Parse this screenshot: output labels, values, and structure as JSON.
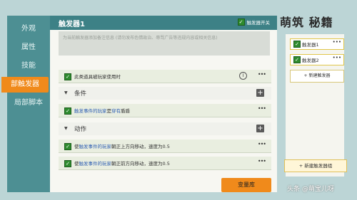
{
  "sidebar": {
    "items": [
      {
        "label": "外观"
      },
      {
        "label": "属性"
      },
      {
        "label": "技能"
      },
      {
        "label": "部触发器"
      },
      {
        "label": "局部脚本"
      }
    ]
  },
  "main": {
    "title": "触发器1",
    "toggle_label": "触发器开关",
    "note": "为当前触发器添加备注信息 (请勿发布色情政治、辱骂广告等违规内容或相关信息)",
    "condition_row": {
      "text": "此类道具被玩家使用时"
    },
    "sections": [
      {
        "label": "条件"
      },
      {
        "label": "动作"
      }
    ],
    "condition_items": [
      {
        "prefix": "触发事件的玩家",
        "mid": "是",
        "suffix": "穿有",
        "hl": "盾盾"
      }
    ],
    "action_items": [
      {
        "prefix": "使",
        "hl": "触发事件的玩家",
        "rest": "朝正上方向移动，速度为0.5"
      },
      {
        "prefix": "使",
        "hl": "触发事件的玩家",
        "rest": "朝正前方向移动，速度为0.5"
      }
    ],
    "bottom_button": "变量库"
  },
  "right": {
    "items": [
      {
        "label": "触发器1"
      },
      {
        "label": "触发器2"
      }
    ],
    "add_trigger": "新建触发器",
    "add_group": "新建触发器组"
  },
  "watermarks": {
    "top": "萌筑 秘籍",
    "bottom": "头条 @萌宝儿呀"
  },
  "colors": {
    "sidebar_bg": "#4d8f93",
    "active_tab": "#f08a1b",
    "titlebar_bg": "#3d8186",
    "checkbox": "#2e8b2e",
    "highlight_text": "#2f5fb3"
  }
}
